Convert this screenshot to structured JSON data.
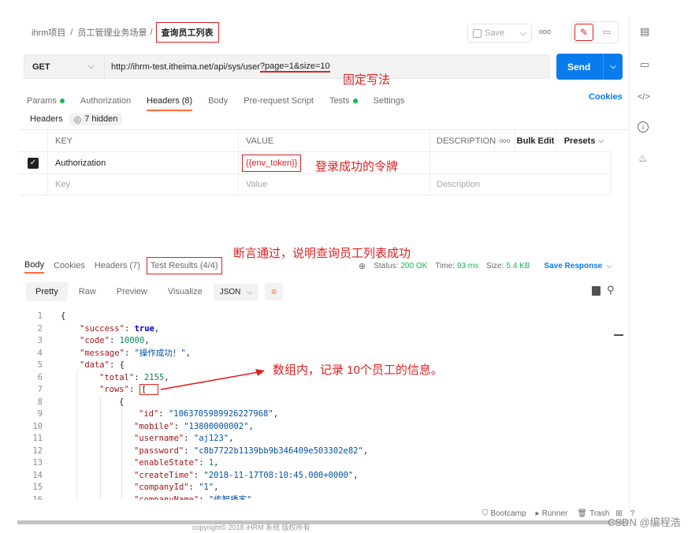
{
  "breadcrumb": {
    "project": "ihrm项目",
    "sep1": "/",
    "folder": "员工管理业务场景",
    "sep2": "/",
    "request": "查询员工列表"
  },
  "toolbar": {
    "save": "Save",
    "more": "ooo"
  },
  "request": {
    "method": "GET",
    "url_prefix": "http://ihrm-test.itheima.net/api/sys/user",
    "url_query": "?page=1&size=10",
    "send": "Send"
  },
  "annotations": {
    "fixed": "固定写法",
    "login": "登录成功的令牌",
    "assert": "断言通过，说明查询员工列表成功",
    "array": "数组内，记录 10个员工的信息。"
  },
  "request_tabs": [
    "Params",
    "Authorization",
    "Headers (8)",
    "Body",
    "Pre-request Script",
    "Tests",
    "Settings"
  ],
  "cookies": "Cookies",
  "headers_bar": {
    "title": "Headers",
    "hidden": "7 hidden"
  },
  "table": {
    "col_key": "KEY",
    "col_value": "VALUE",
    "col_desc": "DESCRIPTION",
    "more": "ooo",
    "bulk": "Bulk Edit",
    "presets": "Presets",
    "row_key": "Authorization",
    "row_value": "{{env_token}}",
    "ph_key": "Key",
    "ph_value": "Value",
    "ph_desc": "Description"
  },
  "response_tabs": {
    "body": "Body",
    "cookies": "Cookies",
    "headers": "Headers (7)",
    "tests": "Test Results (4/4)"
  },
  "status": {
    "status_label": "Status:",
    "status_value": "200 OK",
    "time_label": "Time:",
    "time_value": "93 ms",
    "size_label": "Size:",
    "size_value": "5.4 KB",
    "save_response": "Save Response"
  },
  "view_tabs": {
    "pretty": "Pretty",
    "raw": "Raw",
    "preview": "Preview",
    "visualize": "Visualize",
    "format": "JSON"
  },
  "code_lines": [
    {
      "n": "1",
      "t": "{"
    },
    {
      "n": "2",
      "t": "\"success\": true,"
    },
    {
      "n": "3",
      "t": "\"code\": 10000,"
    },
    {
      "n": "4",
      "t": "\"message\": \"操作成功！\","
    },
    {
      "n": "5",
      "t": "\"data\": {"
    },
    {
      "n": "6",
      "t": "\"total\": 2155,"
    },
    {
      "n": "7",
      "t": "\"rows\": ["
    },
    {
      "n": "8",
      "t": "{"
    },
    {
      "n": "9",
      "t": "\"id\": \"1063705989926227968\","
    },
    {
      "n": "10",
      "t": "\"mobile\": \"13800000002\","
    },
    {
      "n": "11",
      "t": "\"username\": \"aj123\","
    },
    {
      "n": "12",
      "t": "\"password\": \"c8b7722b1139bb9b346409e503302e82\","
    },
    {
      "n": "13",
      "t": "\"enableState\": 1,"
    },
    {
      "n": "14",
      "t": "\"createTime\": \"2018-11-17T08:10:45.000+0000\","
    },
    {
      "n": "15",
      "t": "\"companyId\": \"1\","
    },
    {
      "n": "16",
      "t": "\"companyName\": \"传智播客\","
    }
  ],
  "footer": {
    "bootcamp": "Bootcamp",
    "runner": "Runner",
    "trash": "Trash",
    "copyright": "copyright© 2018 iHRM 系统 版权所有",
    "watermark": "CSDN @编程浩"
  },
  "colors": {
    "accent": "#ff6c37",
    "send": "#097bed",
    "green": "#0cbb52",
    "annotation": "#e02020"
  }
}
